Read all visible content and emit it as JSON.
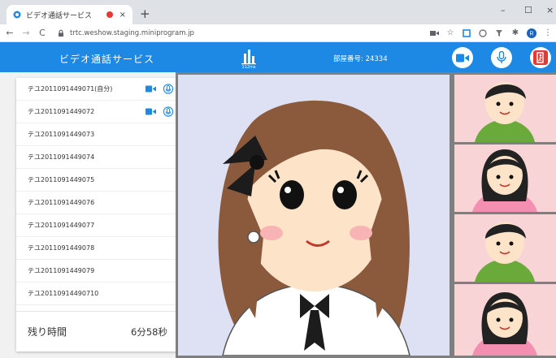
{
  "browser": {
    "tab_title": "ビデオ通話サービス",
    "tab_close": "×",
    "new_tab": "+",
    "url": "trtc.weshow.staging.miniprogram.jp",
    "window_controls": [
      "–",
      "☐",
      "×"
    ],
    "avatar_initial": "R"
  },
  "app": {
    "title": "ビデオ通話サービス",
    "signal_label": "112ms",
    "room_number": "部屋番号: 24334"
  },
  "participants": [
    {
      "name": "テユ2011091449071(自分)",
      "video": true,
      "mic": true
    },
    {
      "name": "テユ2011091449072",
      "video": true,
      "mic": true
    },
    {
      "name": "テユ2011091449073",
      "video": false,
      "mic": false
    },
    {
      "name": "テユ2011091449074",
      "video": false,
      "mic": false
    },
    {
      "name": "テユ2011091449075",
      "video": false,
      "mic": false
    },
    {
      "name": "テユ2011091449076",
      "video": false,
      "mic": false
    },
    {
      "name": "テユ2011091449077",
      "video": false,
      "mic": false
    },
    {
      "name": "テユ2011091449078",
      "video": false,
      "mic": false
    },
    {
      "name": "テユ2011091449079",
      "video": false,
      "mic": false
    },
    {
      "name": "テユ20110914490710",
      "video": false,
      "mic": false
    }
  ],
  "remaining_time": {
    "label": "残り時間",
    "value": "6分58秒"
  },
  "colors": {
    "accent": "#1e88e5",
    "exit": "#e53935",
    "thumb_bg": "#f8d4d6",
    "main_bg": "#dde1f3"
  },
  "icons": {
    "camera": "video-camera-icon",
    "mic": "microphone-icon",
    "exit": "exit-door-icon",
    "signal": "signal-bars-icon"
  }
}
